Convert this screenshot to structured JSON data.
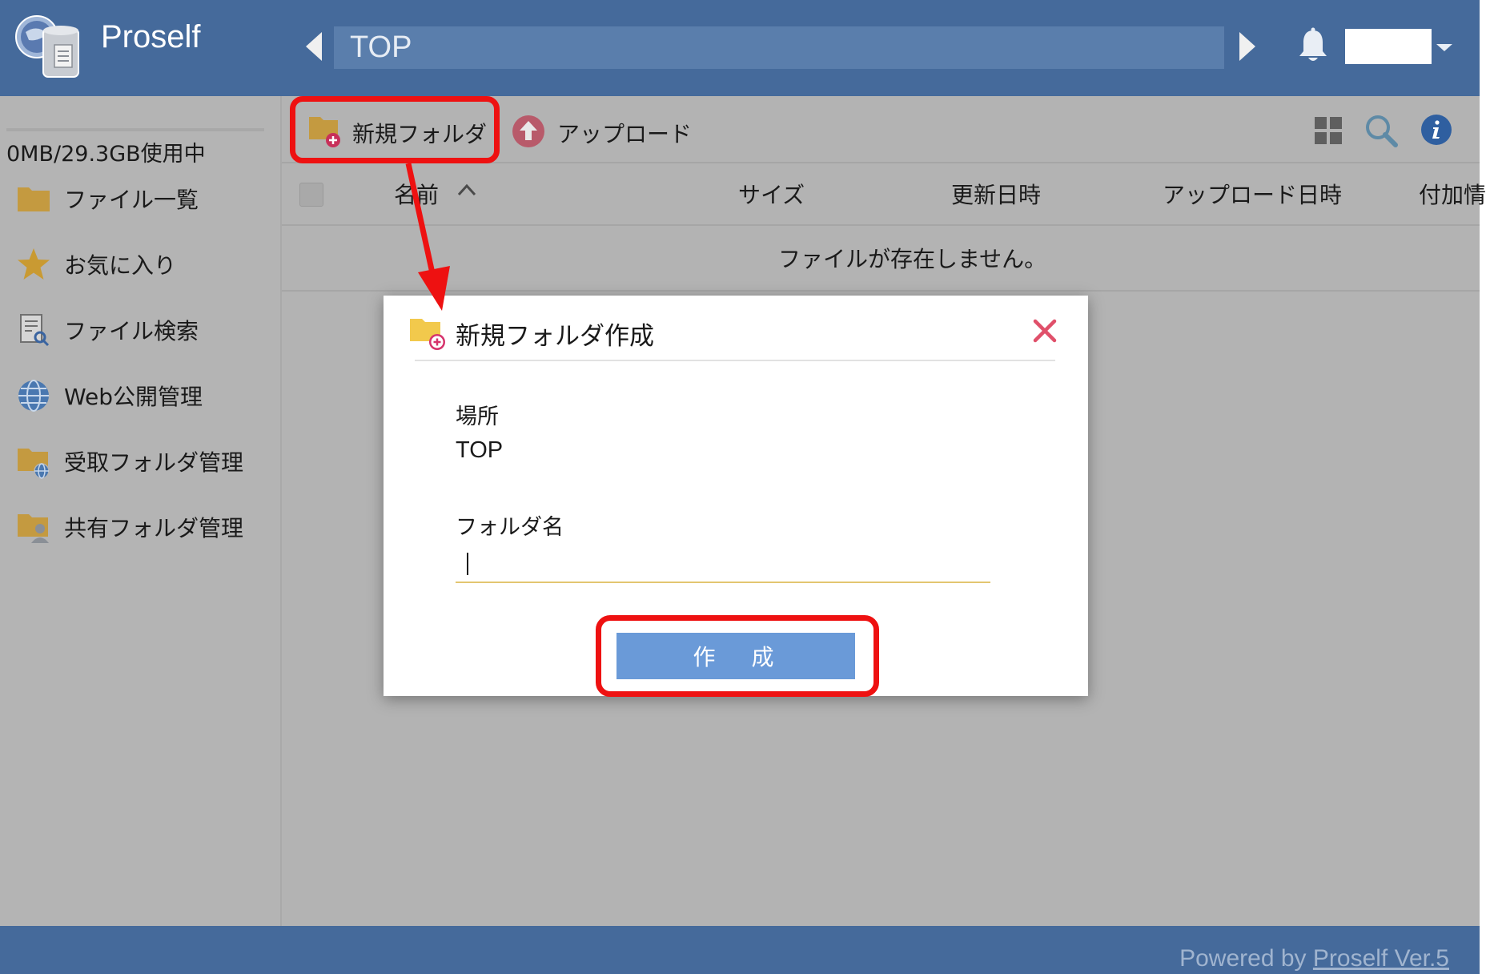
{
  "header": {
    "app_title": "Proself",
    "path": "TOP"
  },
  "sidebar": {
    "storage": "0MB/29.3GB使用中",
    "items": [
      {
        "label": "ファイル一覧"
      },
      {
        "label": "お気に入り"
      },
      {
        "label": "ファイル検索"
      },
      {
        "label": "Web公開管理"
      },
      {
        "label": "受取フォルダ管理"
      },
      {
        "label": "共有フォルダ管理"
      }
    ]
  },
  "toolbar": {
    "new_folder_label": "新規フォルダ",
    "upload_label": "アップロード"
  },
  "table": {
    "columns": [
      "名前",
      "サイズ",
      "更新日時",
      "アップロード日時",
      "付加情"
    ],
    "empty_message": "ファイルが存在しません。"
  },
  "dialog": {
    "title": "新規フォルダ作成",
    "location_label": "場所",
    "location_value": "TOP",
    "name_label": "フォルダ名",
    "name_value": "",
    "create_label": "作 成"
  },
  "footer": {
    "powered_by": "Powered by",
    "link_text": "Proself Ver.5"
  },
  "colors": {
    "header_bg": "#456a9b",
    "highlight_red": "#ee1111",
    "create_button": "#6a9ad8",
    "folder_yellow": "#d8a93a"
  }
}
